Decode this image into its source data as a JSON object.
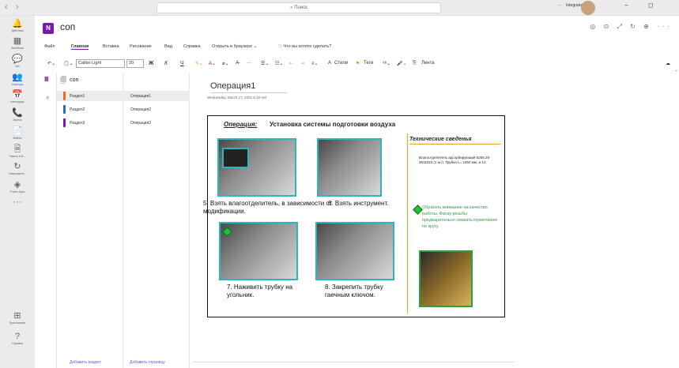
{
  "titlebar": {
    "search_placeholder": "Поиск",
    "nav_back": "‹",
    "nav_forward": "›",
    "more": "···",
    "org": "Integrator OOO",
    "minimize": "−",
    "maximize": "◻"
  },
  "rail": [
    {
      "label": "Действия",
      "icon": "bell-icon",
      "glyph": "🔔"
    },
    {
      "label": "Workflows",
      "icon": "grid-icon",
      "glyph": "▦"
    },
    {
      "label": "Чат",
      "icon": "chat-icon",
      "glyph": "💬"
    },
    {
      "label": "Команды",
      "icon": "teams-icon",
      "glyph": "👥"
    },
    {
      "label": "Календарь",
      "icon": "calendar-icon",
      "glyph": "📅"
    },
    {
      "label": "Звонки",
      "icon": "phone-icon",
      "glyph": "📞"
    },
    {
      "label": "Файлы",
      "icon": "file-icon",
      "glyph": "📄"
    },
    {
      "label": "Тикеты в В...",
      "icon": "ticket-icon",
      "glyph": "🗎"
    },
    {
      "label": "Утверждени...",
      "icon": "approvals-icon",
      "glyph": "↻"
    },
    {
      "label": "Power Apps",
      "icon": "powerapps-icon",
      "glyph": "◈"
    },
    {
      "label": "",
      "icon": "more-icon",
      "glyph": "···"
    },
    {
      "label": "Приложения",
      "icon": "apps-icon",
      "glyph": "⊞"
    },
    {
      "label": "Справка",
      "icon": "help-icon",
      "glyph": "?"
    }
  ],
  "app": {
    "title": "соп",
    "badge": "N",
    "head_icons": "◎ ⊙ ⤢ ↻ ⊕ ···"
  },
  "menu": [
    "Файл",
    "Главная",
    "Вставка",
    "Рисование",
    "Вид",
    "Справка",
    "Открыть в браузере ⌄",
    "♡ Что вы хотите сделать?"
  ],
  "ribbon": {
    "font": "Calibri Light",
    "size": "20",
    "bold": "Ж",
    "italic": "К",
    "underline": "Ч",
    "styles": "Стили",
    "tags": "Теги",
    "tape": "Лента"
  },
  "notebook": {
    "title": "соп",
    "add_section": "Добавить раздел",
    "add_page": "Добавить страницу"
  },
  "rows": [
    {
      "section": "Раздел1",
      "page": "Операция1",
      "color": "#e86c1f"
    },
    {
      "section": "Раздел2",
      "page": "Операция2",
      "color": "#1f6fbf"
    },
    {
      "section": "Раздел3",
      "page": "Операция3",
      "color": "#7719aa"
    }
  ],
  "page": {
    "title": "Операция1",
    "date": "Wednesday, March 17, 2021   6:18 AM"
  },
  "doc": {
    "op_label": "Операция:",
    "heading": "Установка системы подготовки воздуха",
    "captions": [
      "5. Взять влагоотделитель, в зависимости от модификации.",
      "6. Взять инструмент.",
      "7. Наживить трубку на угольник.",
      "8. Закрепить трубку гаечным ключом."
    ],
    "info_title": "Технические сведенья",
    "info_text": "Влагоотделитель адсорбирующий 5256.25-3511010 (1 шт). Трубка  L= 1050 мм; ø 12.",
    "info_green": "Обратить внимание на качество работы. Фаску резьбы предварительно смазать герметиком по кругу."
  }
}
